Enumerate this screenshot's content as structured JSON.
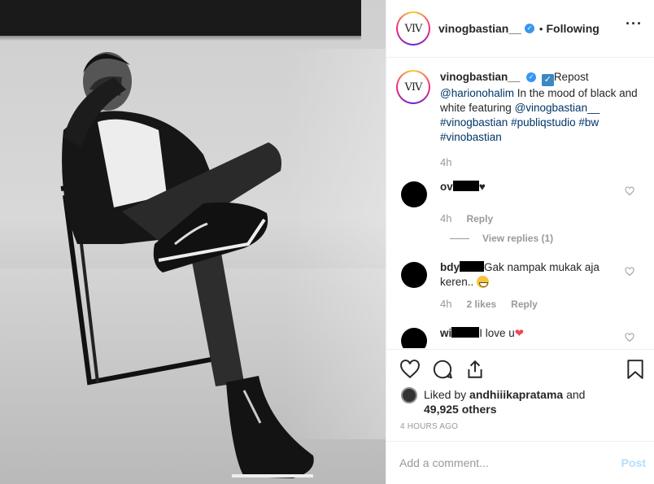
{
  "photo": {
    "alt_subject": "black-and-white-photo"
  },
  "header": {
    "avatar_logo": "VIV",
    "username": "vinogbastian__",
    "separator": "•",
    "follow_state": "Following",
    "more_icon": "more-horizontal-icon"
  },
  "caption": {
    "username": "vinogbastian__",
    "repost": "Repost",
    "mention": "@harionohalim",
    "text": " In the mood of black and white featuring ",
    "mention2": "@vinogbastian__",
    "hashtags": "#vinogbastian #publiqstudio #bw #vinobastian",
    "time": "4h"
  },
  "comments": [
    {
      "user": "ov",
      "text": "♥",
      "time": "4h",
      "reply": "Reply",
      "view_replies": "View replies (1)"
    },
    {
      "user": "bdy",
      "text": "Gak nampak mukak aja keren..",
      "time": "4h",
      "likes": "2 likes",
      "reply": "Reply"
    },
    {
      "user": "wi",
      "text": "I love u",
      "emoji": "❤"
    }
  ],
  "likes": {
    "prefix": "Liked by",
    "user": "andhiiikapratama",
    "and": "and",
    "count": "49,925 others"
  },
  "posted": "4 HOURS AGO",
  "add_comment": {
    "placeholder": "Add a comment...",
    "post": "Post"
  }
}
